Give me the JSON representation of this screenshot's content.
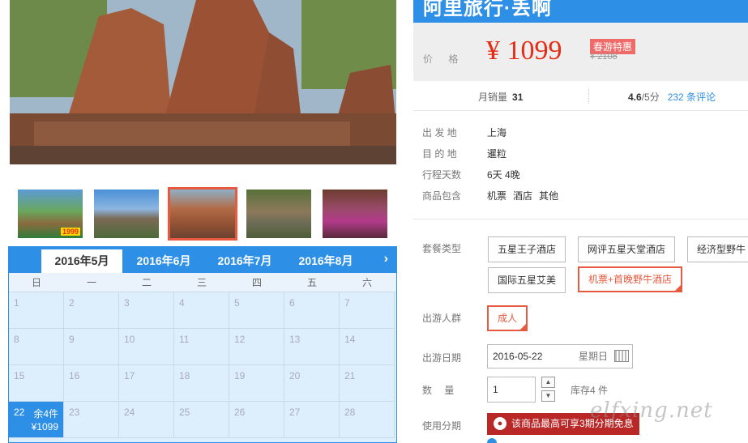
{
  "product": {
    "title": "阿里旅行·丢啊",
    "price_label": "价 格",
    "price": "¥ 1099",
    "promo_tag": "春游特惠",
    "old_price": "¥ 2108"
  },
  "stats": {
    "sales_label": "月销量",
    "sales_value": "31",
    "rating_value": "4.6",
    "rating_suffix": "/5分",
    "reviews": "232 条评论"
  },
  "info": [
    {
      "label": "出 发 地",
      "value": "上海"
    },
    {
      "label": "目 的 地",
      "value": "暹粒"
    },
    {
      "label": "行程天数",
      "value": "6天 4晚"
    },
    {
      "label": "商品包含",
      "value_items": [
        "机票",
        "酒店",
        "其他"
      ]
    }
  ],
  "options": {
    "package_label": "套餐类型",
    "packages": [
      "五星王子酒店",
      "网评五星天堂酒店",
      "经济型野牛",
      "国际五星艾美",
      "机票+首晚野牛酒店"
    ],
    "selected_package": "机票+首晚野牛酒店",
    "traveler_label": "出游人群",
    "traveler": "成人",
    "date_label": "出游日期",
    "date_value": "2016-05-22",
    "date_weekday": "星期日",
    "qty_label": "数 量",
    "qty_value": "1",
    "stock": "库存4 件",
    "installment_label": "使用分期",
    "installment_text": "该商品最高可享3期分期免息"
  },
  "thumbs": [
    {
      "name": "thumb-1",
      "badge": "1999"
    },
    {
      "name": "thumb-2"
    },
    {
      "name": "thumb-3",
      "active": true
    },
    {
      "name": "thumb-4"
    },
    {
      "name": "thumb-5"
    }
  ],
  "calendar": {
    "tabs": [
      "2016年5月",
      "2016年6月",
      "2016年7月",
      "2016年8月"
    ],
    "active_tab": "2016年5月",
    "weekdays": [
      "日",
      "一",
      "二",
      "三",
      "四",
      "五",
      "六"
    ],
    "rows": [
      [
        "1",
        "2",
        "3",
        "4",
        "5",
        "6",
        "7"
      ],
      [
        "8",
        "9",
        "10",
        "11",
        "12",
        "13",
        "14"
      ],
      [
        "15",
        "16",
        "17",
        "18",
        "19",
        "20",
        "21"
      ],
      [
        "22",
        "23",
        "24",
        "25",
        "26",
        "27",
        "28"
      ]
    ],
    "selected_day": "22",
    "selected_stock": "余4件",
    "selected_price": "¥1099"
  },
  "watermark": "elfxing.net",
  "colors": {
    "accent_blue": "#2d8fe6",
    "price_red": "#e62c17",
    "select_orange": "#e85a3f"
  }
}
